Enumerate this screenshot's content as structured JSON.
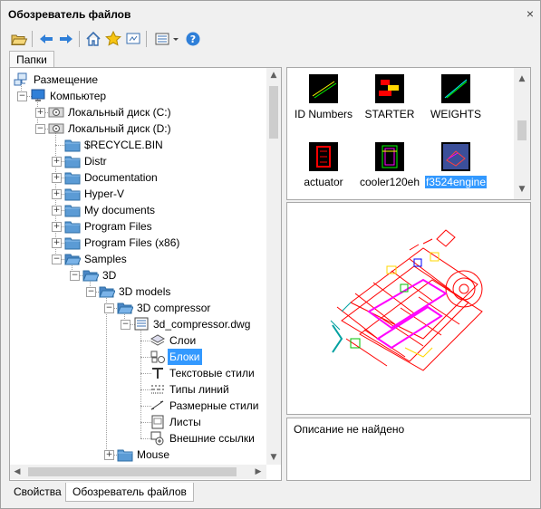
{
  "window": {
    "title": "Обозреватель файлов",
    "close": "×"
  },
  "toolbar": {
    "items": [
      "open-folder-icon",
      "back-icon",
      "forward-icon",
      "home-icon",
      "favorites-icon",
      "desktop-icon",
      "views-icon",
      "dropdown-icon",
      "help-icon"
    ]
  },
  "tabs": {
    "folders": "Папки"
  },
  "tree": {
    "nodes": [
      {
        "label": "Размещение",
        "icon": "network-icon"
      },
      {
        "label": "Компьютер",
        "icon": "computer-icon"
      },
      {
        "label": "Локальный диск (C:)",
        "icon": "drive-icon"
      },
      {
        "label": "Локальный диск (D:)",
        "icon": "drive-icon"
      },
      {
        "label": "$RECYCLE.BIN",
        "icon": "folder-icon"
      },
      {
        "label": "Distr",
        "icon": "folder-icon"
      },
      {
        "label": "Documentation",
        "icon": "folder-icon"
      },
      {
        "label": "Hyper-V",
        "icon": "folder-icon"
      },
      {
        "label": "My documents",
        "icon": "folder-icon"
      },
      {
        "label": "Program Files",
        "icon": "folder-icon"
      },
      {
        "label": "Program Files (x86)",
        "icon": "folder-icon"
      },
      {
        "label": "Samples",
        "icon": "folder-open-icon"
      },
      {
        "label": "3D",
        "icon": "folder-open-icon"
      },
      {
        "label": "3D models",
        "icon": "folder-open-icon"
      },
      {
        "label": "3D compressor",
        "icon": "folder-open-icon"
      },
      {
        "label": "3d_compressor.dwg",
        "icon": "dwg-icon"
      },
      {
        "label": "Слои",
        "icon": "layers-icon"
      },
      {
        "label": "Блоки",
        "icon": "blocks-icon"
      },
      {
        "label": "Текстовые стили",
        "icon": "text-style-icon"
      },
      {
        "label": "Типы линий",
        "icon": "linetype-icon"
      },
      {
        "label": "Размерные стили",
        "icon": "dimstyle-icon"
      },
      {
        "label": "Листы",
        "icon": "layouts-icon"
      },
      {
        "label": "Внешние ссылки",
        "icon": "xref-icon"
      },
      {
        "label": "Mouse",
        "icon": "folder-icon"
      }
    ]
  },
  "blocks": {
    "items": [
      {
        "name": "ID Numbers"
      },
      {
        "name": "STARTER"
      },
      {
        "name": "WEIGHTS"
      },
      {
        "name": "actuator"
      },
      {
        "name": "cooler120eh"
      },
      {
        "name": "f3524engine",
        "selected": true
      }
    ]
  },
  "description": {
    "text": "Описание не найдено"
  },
  "bottom_tabs": {
    "properties": "Свойства",
    "file_browser": "Обозреватель файлов"
  },
  "colors": {
    "selection": "#3399ff",
    "drawing_red": "#ff0000",
    "drawing_magenta": "#ff00ff"
  }
}
